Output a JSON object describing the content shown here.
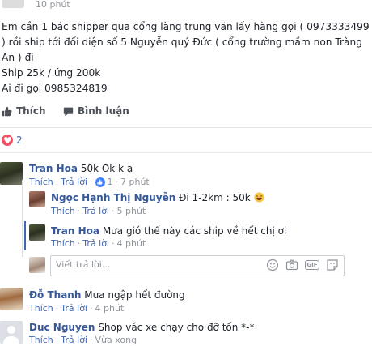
{
  "post": {
    "timestamp": "10 phút",
    "lines": [
      "Em cần 1 bác shipper qua cổng làng trung văn lấy hàng gọi ( 0973333499",
      ") rồi ship tới đối diện số 5 Nguyễn quý Đức ( cổng trường mầm non Tràng",
      "An ) đi",
      "Ship 25k / ứng 200k",
      "Ai đi gọi 0985324819"
    ],
    "actions": {
      "like": "Thích",
      "comment": "Bình luận"
    },
    "reaction_count": "2"
  },
  "comments": [
    {
      "name": "Tran Hoa",
      "text": "50k Ok k ạ",
      "like": "Thích",
      "reply": "Trả lời",
      "likes": "1",
      "time": "7 phút"
    },
    {
      "name": "Ngọc Hạnh Thị Nguyễn",
      "text": "Đi 1-2km : 50k",
      "like": "Thích",
      "reply": "Trả lời",
      "time": "5 phút"
    },
    {
      "name": "Tran Hoa",
      "text": "Mưa gió thế này các ship về hết chị ơi",
      "like": "Thích",
      "reply": "Trả lời",
      "time": "4 phút"
    },
    {
      "name": "Đỗ Thanh",
      "text": "Mưa ngập hết đường",
      "like": "Thích",
      "reply": "Trả lời",
      "time": "4 phút"
    },
    {
      "name": "Duc Nguyen",
      "text": "Shop vác xe chạy cho đỡ tốn *-*",
      "like": "Thích",
      "reply": "Trả lời",
      "time": "Vừa xong"
    }
  ],
  "reply_box": {
    "placeholder": "Viết trả lời..."
  },
  "colors": {
    "link": "#365899",
    "meta": "#90949c",
    "heart": "#f25268",
    "like_badge": "#4080ff"
  }
}
